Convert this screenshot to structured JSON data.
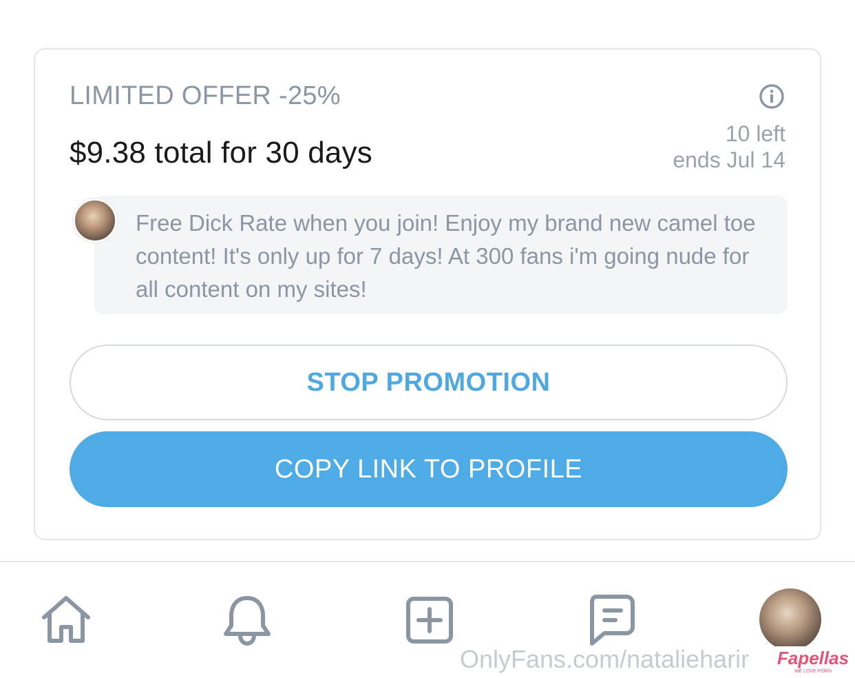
{
  "offer": {
    "title": "LIMITED OFFER -25%",
    "price_text": "$9.38 total for 30 days",
    "remaining": "10 left",
    "ends": "ends Jul 14",
    "message": "Free Dick Rate when you join! Enjoy my brand new camel toe content! It's only up for 7 days! At 300 fans i'm going nude for all content on my sites!"
  },
  "buttons": {
    "stop_label": "STOP PROMOTION",
    "copy_label": "COPY LINK TO PROFILE"
  },
  "nav": {
    "icons": [
      "home-icon",
      "bell-icon",
      "add-post-icon",
      "messages-icon",
      "profile-avatar"
    ]
  },
  "watermark": {
    "url_text": "OnlyFans.com/natalieharir",
    "brand": "Fapellas",
    "brand_tagline": "WE LOVE PORN"
  },
  "colors": {
    "accent": "#4fabe6",
    "muted_text": "#8a96a3",
    "brand": "#e35479"
  }
}
